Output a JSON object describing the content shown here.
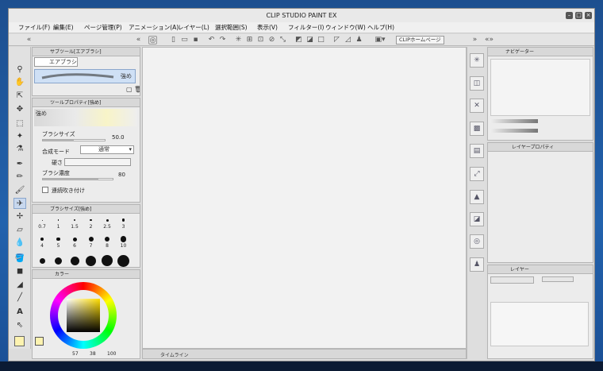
{
  "window": {
    "title": "CLIP STUDIO PAINT EX"
  },
  "menu": [
    "ファイル(F)",
    "編集(E)",
    "ページ管理(P)",
    "アニメーション(A)",
    "レイヤー(L)",
    "選択範囲(S)",
    "表示(V)",
    "フィルター(I)",
    "ウィンドウ(W)",
    "ヘルプ(H)"
  ],
  "command_bar": {
    "home_label": "CLIPホームページ"
  },
  "subtool_panel": {
    "tab": "サブツール[エアブラシ]",
    "group": "エアブラシ",
    "preset": "強め"
  },
  "tool_property": {
    "tab": "ツールプロパティ[強め]",
    "preset": "強め",
    "brush_size_label": "ブラシサイズ",
    "brush_size_value": "50.0",
    "blend_mode_label": "合成モード",
    "blend_mode_value": "通常",
    "hardness_label": "硬さ",
    "density_label": "ブラシ濃度",
    "density_value": "80",
    "continuous_label": "連続吹き付け"
  },
  "brush_size_panel": {
    "tab": "ブラシサイズ[強め]",
    "sizes": [
      "0.7",
      "1",
      "1.5",
      "2",
      "2.5",
      "3",
      "4",
      "5",
      "6",
      "7",
      "8",
      "10"
    ]
  },
  "color_panel": {
    "tab": "カラー",
    "h": "57",
    "s": "38",
    "v": "100",
    "main_color": "#fdf3b0",
    "sub_color": "#ffffff"
  },
  "timeline": {
    "tab": "タイムライン"
  },
  "navigator": {
    "tab": "ナビゲーター"
  },
  "layer_property": {
    "tab": "レイヤープロパティ"
  },
  "layer_panel": {
    "tab": "レイヤー"
  }
}
